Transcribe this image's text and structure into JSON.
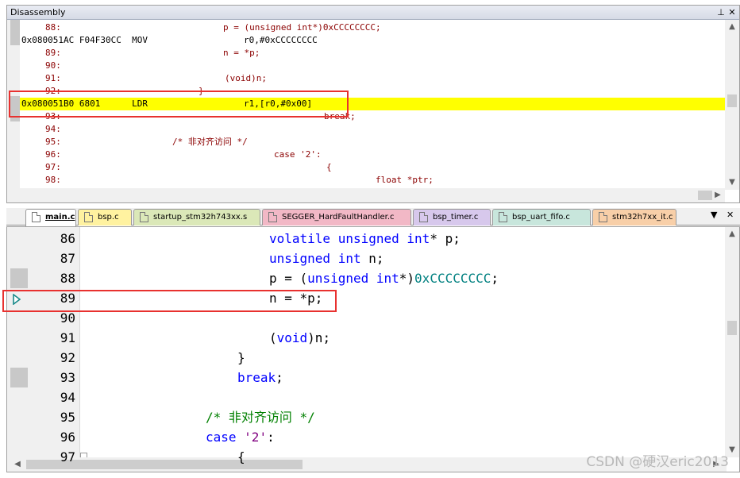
{
  "disassembly": {
    "title": "Disassembly",
    "pin_glyph": "⊥",
    "close_glyph": "✕",
    "lines": [
      {
        "lnum": "88:",
        "src": "p = (unsigned int*)0xCCCCCCCC;"
      },
      {
        "addr": "0x080051AC F04F30CC  MOV",
        "ops": "r0,#0xCCCCCCCC"
      },
      {
        "lnum": "89:",
        "src": "n = *p;"
      },
      {
        "lnum": "90:",
        "src": ""
      },
      {
        "lnum": "91:",
        "src": "(void)n;"
      },
      {
        "lnum": "92:",
        "src": "}"
      },
      {
        "addr": "0x080051B0 6801      LDR",
        "ops": "r1,[r0,#0x00]"
      },
      {
        "lnum": "93:",
        "src": "break;"
      },
      {
        "lnum": "94:",
        "src": ""
      },
      {
        "lnum": "95:",
        "src": "/* 非对齐访问 */"
      },
      {
        "lnum": "96:",
        "src": "case '2':"
      },
      {
        "lnum": "97:",
        "src": "{"
      },
      {
        "lnum": "98:",
        "src": "float *ptr;"
      }
    ]
  },
  "tabs": [
    {
      "label": "main.c",
      "active": true,
      "color": "#ffffff"
    },
    {
      "label": "bsp.c",
      "color": "#fff2a0"
    },
    {
      "label": "startup_stm32h743xx.s",
      "color": "#dbe8b8"
    },
    {
      "label": "SEGGER_HardFaultHandler.c",
      "color": "#f2b8c6"
    },
    {
      "label": "bsp_timer.c",
      "color": "#d7c8ec"
    },
    {
      "label": "bsp_uart_fifo.c",
      "color": "#c8e6dc"
    },
    {
      "label": "stm32h7xx_it.c",
      "color": "#f8cfa8"
    }
  ],
  "tab_menu_glyph": "▼",
  "tab_close_glyph": "✕",
  "editor": {
    "lines": [
      {
        "num": "86",
        "indent": 8,
        "tokens": [
          {
            "t": "volatile",
            "c": "kw"
          },
          {
            "t": " ",
            "c": "plain"
          },
          {
            "t": "unsigned",
            "c": "kw"
          },
          {
            "t": " ",
            "c": "plain"
          },
          {
            "t": "int",
            "c": "kw"
          },
          {
            "t": "* p;",
            "c": "plain"
          }
        ]
      },
      {
        "num": "87",
        "indent": 8,
        "tokens": [
          {
            "t": "unsigned",
            "c": "kw"
          },
          {
            "t": " ",
            "c": "plain"
          },
          {
            "t": "int",
            "c": "kw"
          },
          {
            "t": " n;",
            "c": "plain"
          }
        ]
      },
      {
        "num": "88",
        "indent": 8,
        "tokens": [
          {
            "t": "p = (",
            "c": "plain"
          },
          {
            "t": "unsigned",
            "c": "kw"
          },
          {
            "t": " ",
            "c": "plain"
          },
          {
            "t": "int",
            "c": "kw"
          },
          {
            "t": "*)",
            "c": "plain"
          },
          {
            "t": "0xCCCCCCCC",
            "c": "hx"
          },
          {
            "t": ";",
            "c": "plain"
          }
        ]
      },
      {
        "num": "89",
        "indent": 8,
        "tokens": [
          {
            "t": "n = *p;",
            "c": "plain"
          }
        ]
      },
      {
        "num": "90",
        "indent": 8,
        "tokens": []
      },
      {
        "num": "91",
        "indent": 8,
        "tokens": [
          {
            "t": "(",
            "c": "plain"
          },
          {
            "t": "void",
            "c": "kw"
          },
          {
            "t": ")n;",
            "c": "plain"
          }
        ]
      },
      {
        "num": "92",
        "indent": 7,
        "tokens": [
          {
            "t": "}",
            "c": "plain"
          }
        ]
      },
      {
        "num": "93",
        "indent": 7,
        "tokens": [
          {
            "t": "break",
            "c": "kw"
          },
          {
            "t": ";",
            "c": "plain"
          }
        ]
      },
      {
        "num": "94",
        "indent": 7,
        "tokens": []
      },
      {
        "num": "95",
        "indent": 6,
        "tokens": [
          {
            "t": "/* 非对齐访问 */",
            "c": "cm"
          }
        ]
      },
      {
        "num": "96",
        "indent": 6,
        "tokens": [
          {
            "t": "case",
            "c": "kw"
          },
          {
            "t": " ",
            "c": "plain"
          },
          {
            "t": "'2'",
            "c": "st"
          },
          {
            "t": ":",
            "c": "plain"
          }
        ]
      },
      {
        "num": "97",
        "indent": 7,
        "tokens": [
          {
            "t": "{",
            "c": "plain"
          }
        ]
      }
    ]
  },
  "watermark": "CSDN @硬汉eric2013",
  "colors": {
    "current_line": "#ffff00",
    "highlight_box": "#e8312f"
  }
}
